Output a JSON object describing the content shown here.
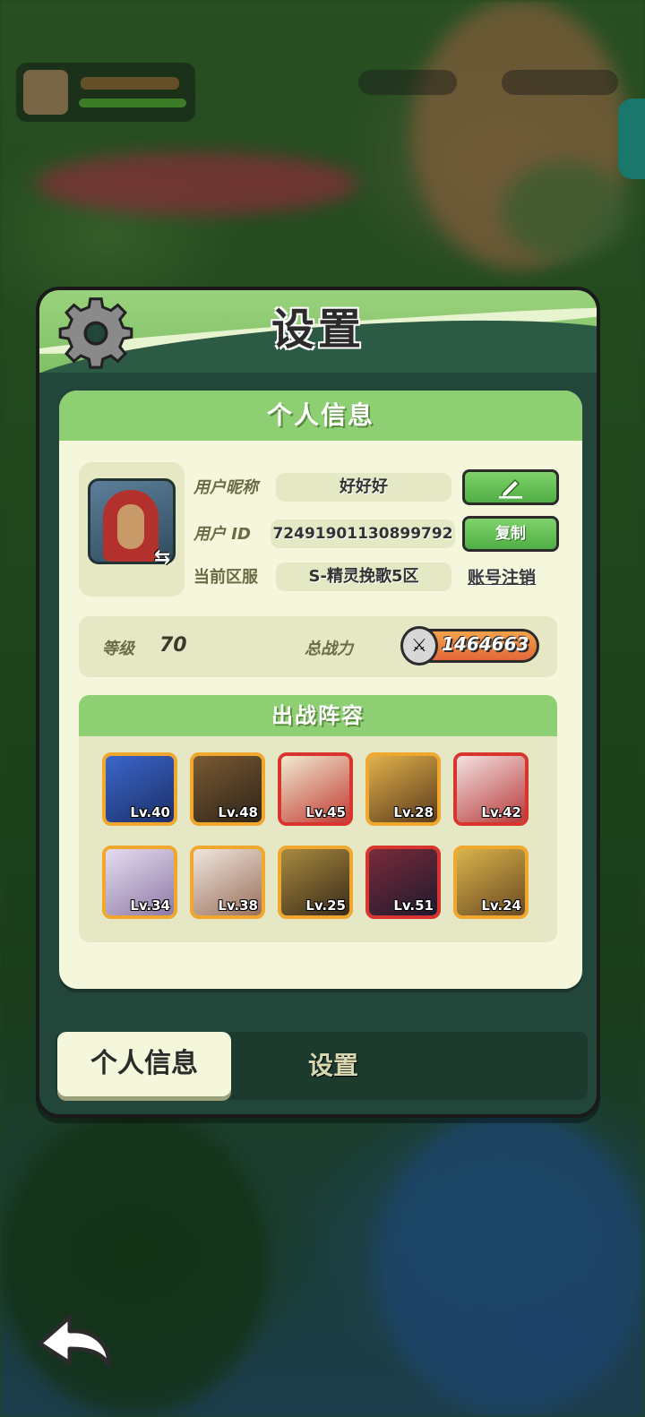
{
  "modal": {
    "title": "设置",
    "section_title": "个人信息",
    "profile": {
      "nickname_label": "用户昵称",
      "nickname": "好好好",
      "id_label": "用户 ID",
      "user_id": "72491901130899792",
      "server_label": "当前区服",
      "server": "S-精灵挽歌5区",
      "edit_icon": "pencil-icon",
      "copy_label": "复制",
      "account_cancel_label": "账号注销",
      "swap_icon": "swap-arrows-icon"
    },
    "stats": {
      "level_label": "等级",
      "level": "70",
      "power_label": "总战力",
      "power": "1464663",
      "power_icon": "crossed-swords-icon"
    },
    "lineup": {
      "title": "出战阵容",
      "heroes": [
        {
          "level": "Lv.40",
          "frame": "orange"
        },
        {
          "level": "Lv.48",
          "frame": "orange"
        },
        {
          "level": "Lv.45",
          "frame": "red"
        },
        {
          "level": "Lv.28",
          "frame": "orange"
        },
        {
          "level": "Lv.42",
          "frame": "red"
        },
        {
          "level": "Lv.34",
          "frame": "orange"
        },
        {
          "level": "Lv.38",
          "frame": "orange"
        },
        {
          "level": "Lv.25",
          "frame": "orange"
        },
        {
          "level": "Lv.51",
          "frame": "red"
        },
        {
          "level": "Lv.24",
          "frame": "orange"
        }
      ]
    },
    "tabs": {
      "active": "个人信息",
      "other": "设置"
    }
  },
  "colors": {
    "panel_green": "#8fcf74",
    "card_cream": "#f5f7dc",
    "button_green": "#4fae45",
    "frame_orange": "#f0a72e",
    "frame_red": "#d8352e"
  },
  "icons": {
    "header": "gear-icon",
    "back": "back-arrow-icon"
  }
}
